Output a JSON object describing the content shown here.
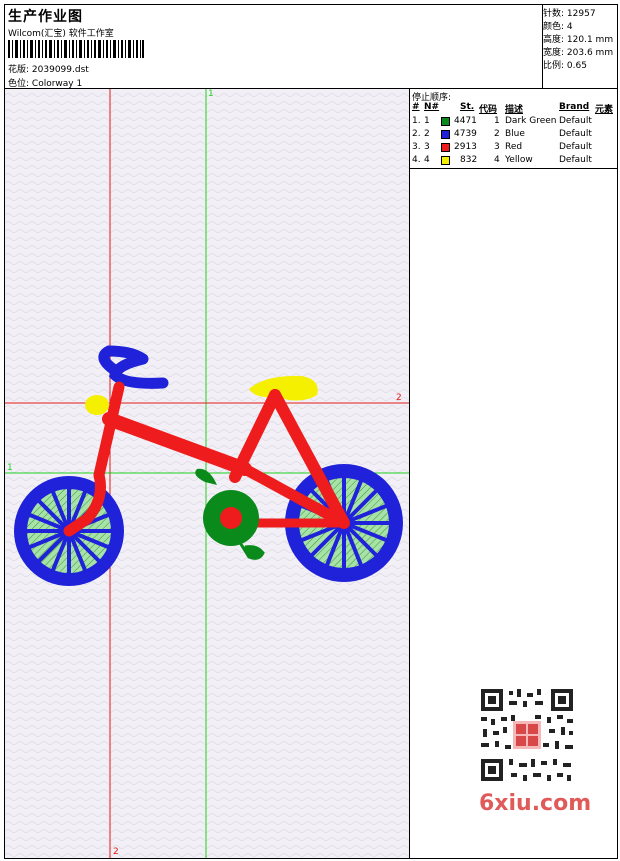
{
  "header": {
    "title": "生产作业图",
    "company": "Wilcom(汇宝) 软件工作室",
    "design_label": "花版:",
    "design_value": "2039099.dst",
    "colorway_label": "色位:",
    "colorway_value": "Colorway 1"
  },
  "stats": [
    {
      "label": "针数:",
      "value": "12957"
    },
    {
      "label": "颜色:",
      "value": "4"
    },
    {
      "label": "高度:",
      "value": "120.1 mm"
    },
    {
      "label": "宽度:",
      "value": "203.6 mm"
    },
    {
      "label": "比例:",
      "value": "0.65"
    }
  ],
  "guides": {
    "top_1": "1",
    "right_2": "2",
    "left_1": "1",
    "bottom_2": "2"
  },
  "stop_sequence": {
    "title": "停止顺序:",
    "headers": {
      "hash": "#",
      "n": "N#",
      "st": "St.",
      "code": "代码",
      "desc": "描述",
      "brand": "Brand",
      "elem": "元素"
    },
    "rows": [
      {
        "num": "1.",
        "n": "1",
        "color": "#0a8a1a",
        "st": "4471",
        "code": "1",
        "desc": "Dark Green",
        "brand": "Default"
      },
      {
        "num": "2.",
        "n": "2",
        "color": "#1f22d8",
        "st": "4739",
        "code": "2",
        "desc": "Blue",
        "brand": "Default"
      },
      {
        "num": "3.",
        "n": "3",
        "color": "#ee1c1c",
        "st": "2913",
        "code": "3",
        "desc": "Red",
        "brand": "Default"
      },
      {
        "num": "4.",
        "n": "4",
        "color": "#f5f000",
        "st": "832",
        "code": "4",
        "desc": "Yellow",
        "brand": "Default"
      }
    ]
  },
  "watermark": {
    "text": "6xiu.com",
    "color": "#e05a5a"
  },
  "colors": {
    "guide_red": "#e01818",
    "guide_green": "#1ed21e",
    "canvas_bg": "#f2f0f6",
    "wheel_fill": "#8fd88f"
  }
}
